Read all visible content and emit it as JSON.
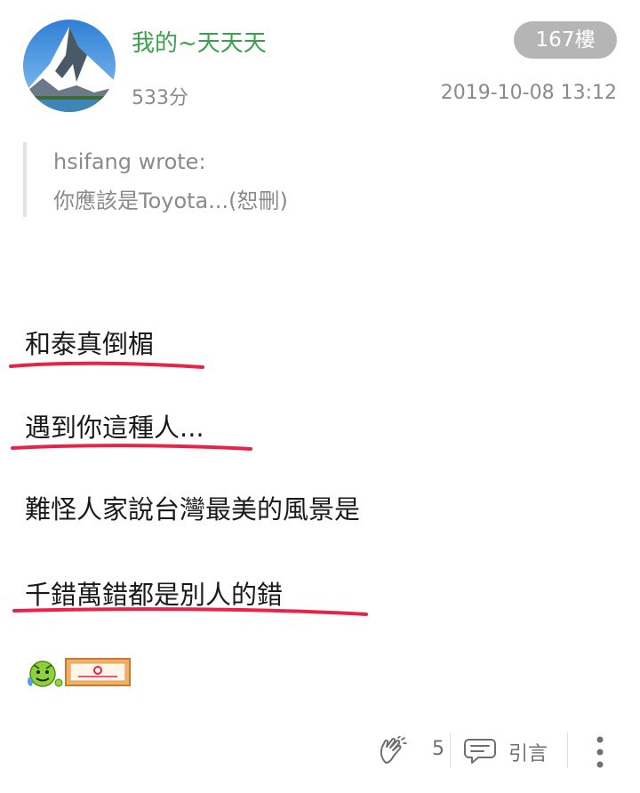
{
  "post": {
    "username": "我的~天天天",
    "floor": "167樓",
    "score": "533分",
    "timestamp": "2019-10-08 13:12",
    "quote": {
      "author": "hsifang wrote:",
      "text": "你應該是Toyota...(恕刪)"
    },
    "lines": [
      "和泰真倒楣",
      "遇到你這種人...",
      "難怪人家說台灣最美的風景是",
      "千錯萬錯都是別人的錯"
    ],
    "underline_color": "#e8234a",
    "username_color": "#3aa04a"
  },
  "footer": {
    "like_count": "5",
    "quote_label": "引言",
    "icons": [
      "clap-icon",
      "quote-bubble-icon",
      "more-vertical-icon"
    ]
  }
}
